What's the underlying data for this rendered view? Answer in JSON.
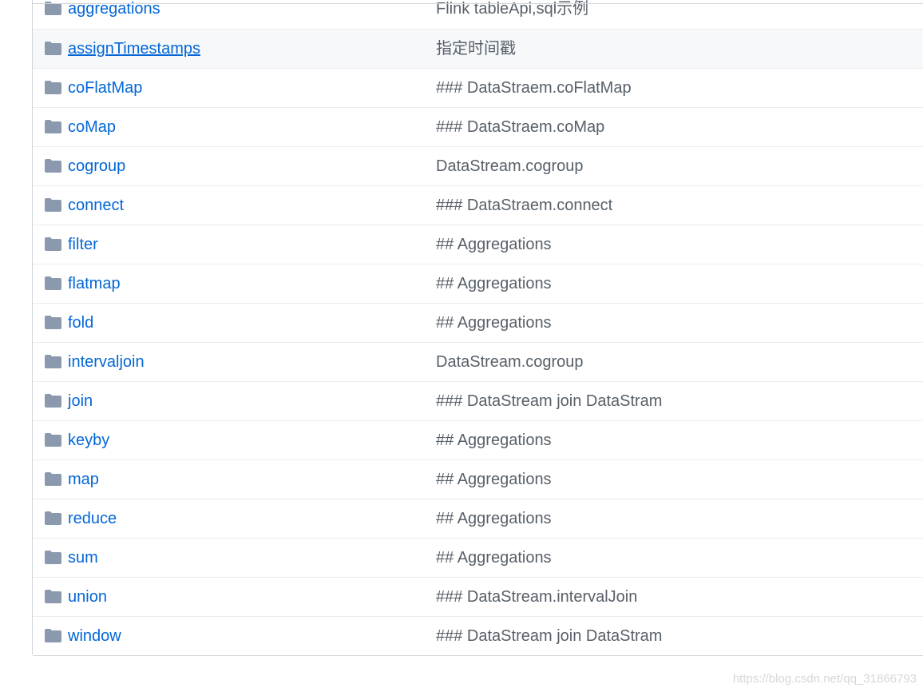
{
  "colors": {
    "link": "#0366d6",
    "message": "#586069",
    "folder_icon": "#79b8ff",
    "row_hover": "#f6f8fa"
  },
  "file_list": {
    "rows": [
      {
        "name": "aggregations",
        "message": "Flink tableApi,sql示例",
        "icon": "folder-icon"
      },
      {
        "name": "assignTimestamps",
        "message": "指定时间戳",
        "icon": "folder-icon",
        "hover": true
      },
      {
        "name": "coFlatMap",
        "message": "### DataStraem.coFlatMap",
        "icon": "folder-icon"
      },
      {
        "name": "coMap",
        "message": "### DataStraem.coMap",
        "icon": "folder-icon"
      },
      {
        "name": "cogroup",
        "message": "DataStream.cogroup",
        "icon": "folder-icon"
      },
      {
        "name": "connect",
        "message": "### DataStraem.connect",
        "icon": "folder-icon"
      },
      {
        "name": "filter",
        "message": "## Aggregations",
        "icon": "folder-icon"
      },
      {
        "name": "flatmap",
        "message": "## Aggregations",
        "icon": "folder-icon"
      },
      {
        "name": "fold",
        "message": "## Aggregations",
        "icon": "folder-icon"
      },
      {
        "name": "intervaljoin",
        "message": "DataStream.cogroup",
        "icon": "folder-icon"
      },
      {
        "name": "join",
        "message": "### DataStream join DataStram",
        "icon": "folder-icon"
      },
      {
        "name": "keyby",
        "message": "## Aggregations",
        "icon": "folder-icon"
      },
      {
        "name": "map",
        "message": "## Aggregations",
        "icon": "folder-icon"
      },
      {
        "name": "reduce",
        "message": "## Aggregations",
        "icon": "folder-icon"
      },
      {
        "name": "sum",
        "message": "## Aggregations",
        "icon": "folder-icon"
      },
      {
        "name": "union",
        "message": "### DataStream.intervalJoin",
        "icon": "folder-icon"
      },
      {
        "name": "window",
        "message": "### DataStream join DataStram",
        "icon": "folder-icon"
      }
    ]
  },
  "watermark": "https://blog.csdn.net/qq_31866793"
}
